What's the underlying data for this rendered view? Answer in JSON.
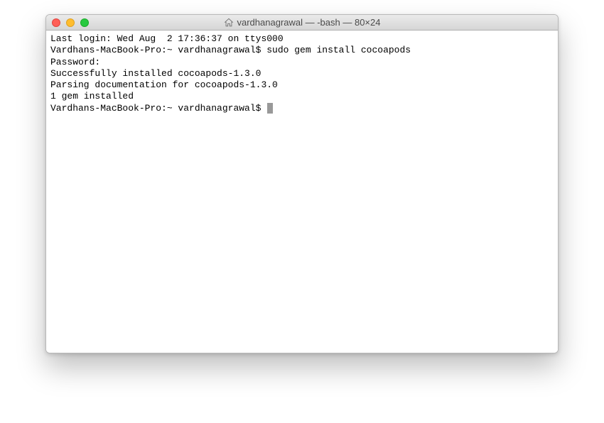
{
  "window": {
    "title": "vardhanagrawal — -bash — 80×24",
    "icon_name": "home-icon"
  },
  "terminal": {
    "lines": [
      "Last login: Wed Aug  2 17:36:37 on ttys000",
      "Vardhans-MacBook-Pro:~ vardhanagrawal$ sudo gem install cocoapods",
      "Password:",
      "Successfully installed cocoapods-1.3.0",
      "Parsing documentation for cocoapods-1.3.0",
      "1 gem installed"
    ],
    "current_prompt": "Vardhans-MacBook-Pro:~ vardhanagrawal$ "
  },
  "colors": {
    "close": "#ff5f57",
    "minimize": "#ffbd2e",
    "maximize": "#28c940"
  }
}
